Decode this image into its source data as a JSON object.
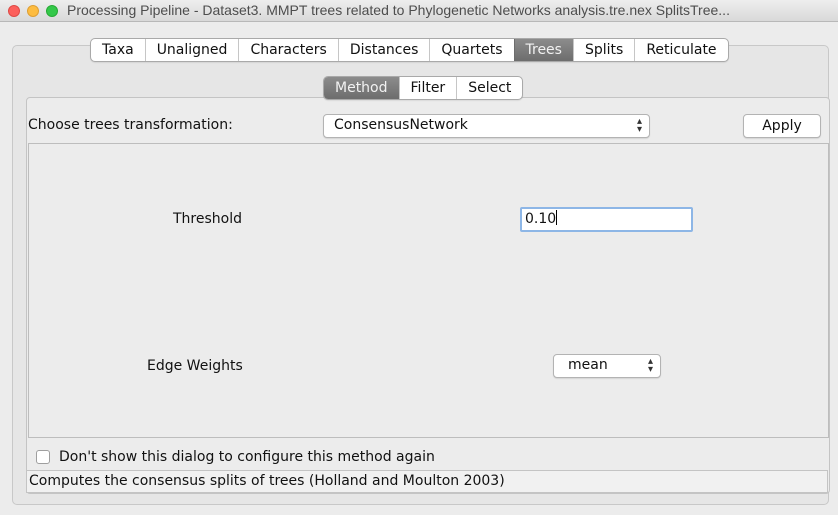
{
  "window": {
    "title": "Processing Pipeline - Dataset3. MMPT trees related to Phylogenetic Networks analysis.tre.nex SplitsTree..."
  },
  "main_tabs": [
    {
      "label": "Taxa",
      "active": false
    },
    {
      "label": "Unaligned",
      "active": false
    },
    {
      "label": "Characters",
      "active": false
    },
    {
      "label": "Distances",
      "active": false
    },
    {
      "label": "Quartets",
      "active": false
    },
    {
      "label": "Trees",
      "active": true
    },
    {
      "label": "Splits",
      "active": false
    },
    {
      "label": "Reticulate",
      "active": false
    }
  ],
  "sub_tabs": [
    {
      "label": "Method",
      "active": true
    },
    {
      "label": "Filter",
      "active": false
    },
    {
      "label": "Select",
      "active": false
    }
  ],
  "transformation": {
    "label": "Choose trees transformation:",
    "selected": "ConsensusNetwork",
    "apply_label": "Apply"
  },
  "params": {
    "threshold_label": "Threshold",
    "threshold_value": "0.10",
    "edge_weights_label": "Edge Weights",
    "edge_weights_value": "mean"
  },
  "dont_show": {
    "label": "Don't show this dialog to configure this method again",
    "checked": false
  },
  "status": {
    "text": "Computes the consensus splits of trees (Holland and Moulton 2003)"
  },
  "colors": {
    "active_tab": "#7d7d7d",
    "focus_ring": "#8db6e6",
    "close": "#fc605c",
    "minimize": "#fdbc40",
    "maximize": "#34c84a"
  }
}
